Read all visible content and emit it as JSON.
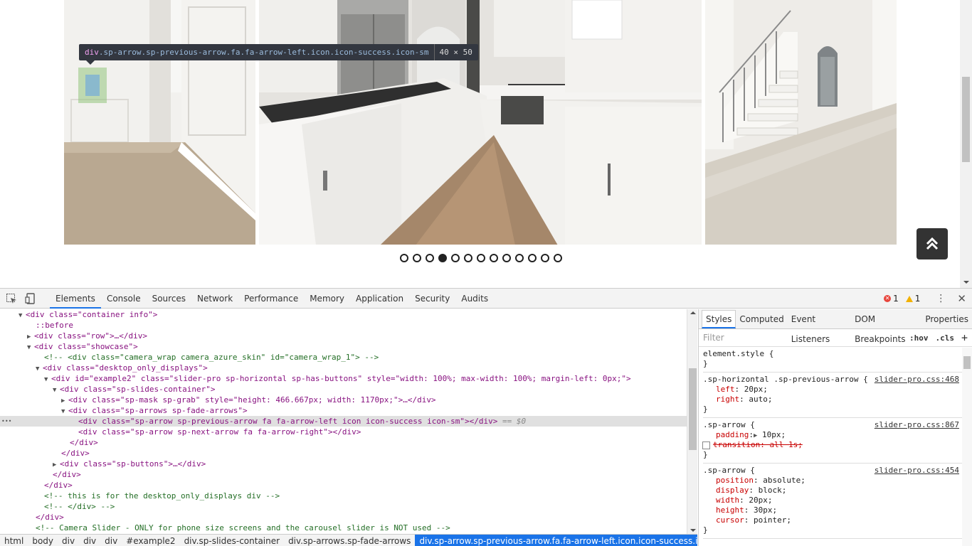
{
  "tooltip": {
    "tag": "div",
    "classes": ".sp-arrow.sp-previous-arrow.fa.fa-arrow-left.icon.icon-success.icon-sm",
    "dims": "40 × 50"
  },
  "carousel": {
    "dot_count": 13,
    "active_index": 3,
    "photos": [
      "hallway-photo",
      "kitchen-photo",
      "staircase-photo"
    ]
  },
  "devtools": {
    "tabs": [
      "Elements",
      "Console",
      "Sources",
      "Network",
      "Performance",
      "Memory",
      "Application",
      "Security",
      "Audits"
    ],
    "active_tab": "Elements",
    "errors": "1",
    "warnings": "1",
    "styles_tabs": [
      "Styles",
      "Computed",
      "Event Listeners",
      "DOM Breakpoints",
      "Properties"
    ],
    "filter_placeholder": "Filter",
    "filter_hov": ":hov",
    "filter_cls": ".cls",
    "breadcrumbs": [
      "html",
      "body",
      "div",
      "div",
      "div",
      "#example2",
      "div.sp-slides-container",
      "div.sp-arrows.sp-fade-arrows",
      "div.sp-arrow.sp-previous-arrow.fa.fa-arrow-left.icon.icon-success.icon-sm"
    ]
  },
  "dom": {
    "l1_tag": "<div class=\"container info\">",
    "l2_pseudo": "::before",
    "l3_tag": "<div class=\"row\">…</div>",
    "l4_tag": "<div class=\"showcase\">",
    "l5_comment": "<!-- <div class=\"camera_wrap camera_azure_skin\" id=\"camera_wrap_1\">   -->",
    "l6_tag": "<div class=\"desktop_only_displays\">",
    "l7_tag": "<div id=\"example2\" class=\"slider-pro sp-horizontal sp-has-buttons\" style=\"width: 100%; max-width: 100%; margin-left: 0px;\">",
    "l8_tag": "<div class=\"sp-slides-container\">",
    "l9_tag": "<div class=\"sp-mask sp-grab\" style=\"height: 466.667px; width: 1170px;\">…</div>",
    "l10_tag": "<div class=\"sp-arrows sp-fade-arrows\">",
    "l11_tag": "<div class=\"sp-arrow sp-previous-arrow fa fa-arrow-left icon icon-success icon-sm\"></div>",
    "l11_eq": "== $0",
    "l11_dots": "•••",
    "l12_tag": "<div class=\"sp-arrow sp-next-arrow fa fa-arrow-right\"></div>",
    "l13_tag": "</div>",
    "l14_tag": "</div>",
    "l15_tag": "<div class=\"sp-buttons\">…</div>",
    "l16_tag": "</div>",
    "l17_tag": "</div>",
    "l18_comment": "<!-- this is for the desktop_only_displays div  -->",
    "l19_comment": "<!-- </div> -->",
    "l20_tag": "</div>",
    "l21_comment": "<!-- Camera Slider - ONLY for phone size screens and the carousel slider is NOT used -->"
  },
  "styles": {
    "r1_sel": "element.style {",
    "r1_close": "}",
    "r2_sel": ".sp-horizontal .sp-previous-arrow {",
    "r2_src": "slider-pro.css:468",
    "r2_p1": "left",
    "r2_v1": "20px;",
    "r2_p2": "right",
    "r2_v2": "auto;",
    "r2_close": "}",
    "r3_sel": ".sp-arrow {",
    "r3_src": "slider-pro.css:867",
    "r3_p1": "padding",
    "r3_v1": "10px;",
    "r3_p2": "transition: all 1s;",
    "r3_close": "}",
    "r4_sel": ".sp-arrow {",
    "r4_src": "slider-pro.css:454",
    "r4_p1": "position",
    "r4_v1": "absolute;",
    "r4_p2": "display",
    "r4_v2": "block;",
    "r4_p3": "width",
    "r4_v3": "20px;",
    "r4_p4": "height",
    "r4_v4": "30px;",
    "r4_p5": "cursor",
    "r4_v5": "pointer;",
    "r4_close": "}"
  }
}
